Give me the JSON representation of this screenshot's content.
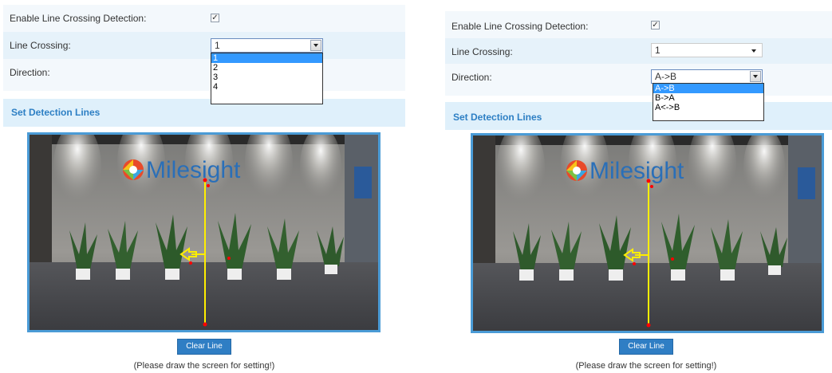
{
  "left": {
    "enable_label": "Enable Line Crossing Detection:",
    "enable_check": "✓",
    "line_crossing_label": "Line Crossing:",
    "line_crossing_value": "1",
    "line_crossing_options": [
      "1",
      "2",
      "3",
      "4"
    ],
    "direction_label": "Direction:",
    "section_title": "Set Detection Lines",
    "logo_text": "Milesight",
    "clear_button": "Clear Line",
    "hint": "(Please draw the screen for setting!)"
  },
  "right": {
    "enable_label": "Enable Line Crossing Detection:",
    "enable_check": "✓",
    "line_crossing_label": "Line Crossing:",
    "line_crossing_value": "1",
    "direction_label": "Direction:",
    "direction_value": "A->B",
    "direction_options": [
      "A->B",
      "B->A",
      "A<->B"
    ],
    "section_title": "Set Detection Lines",
    "logo_text": "Milesight",
    "clear_button": "Clear Line",
    "hint": "(Please draw the screen for setting!)"
  },
  "colors": {
    "row_light": "#f3f8fc",
    "row_tinted": "#e6f2fa",
    "section_bg": "#dff0fb",
    "accent": "#2d7fc4",
    "detection_line": "#ffee00",
    "marker": "#ff0000"
  }
}
